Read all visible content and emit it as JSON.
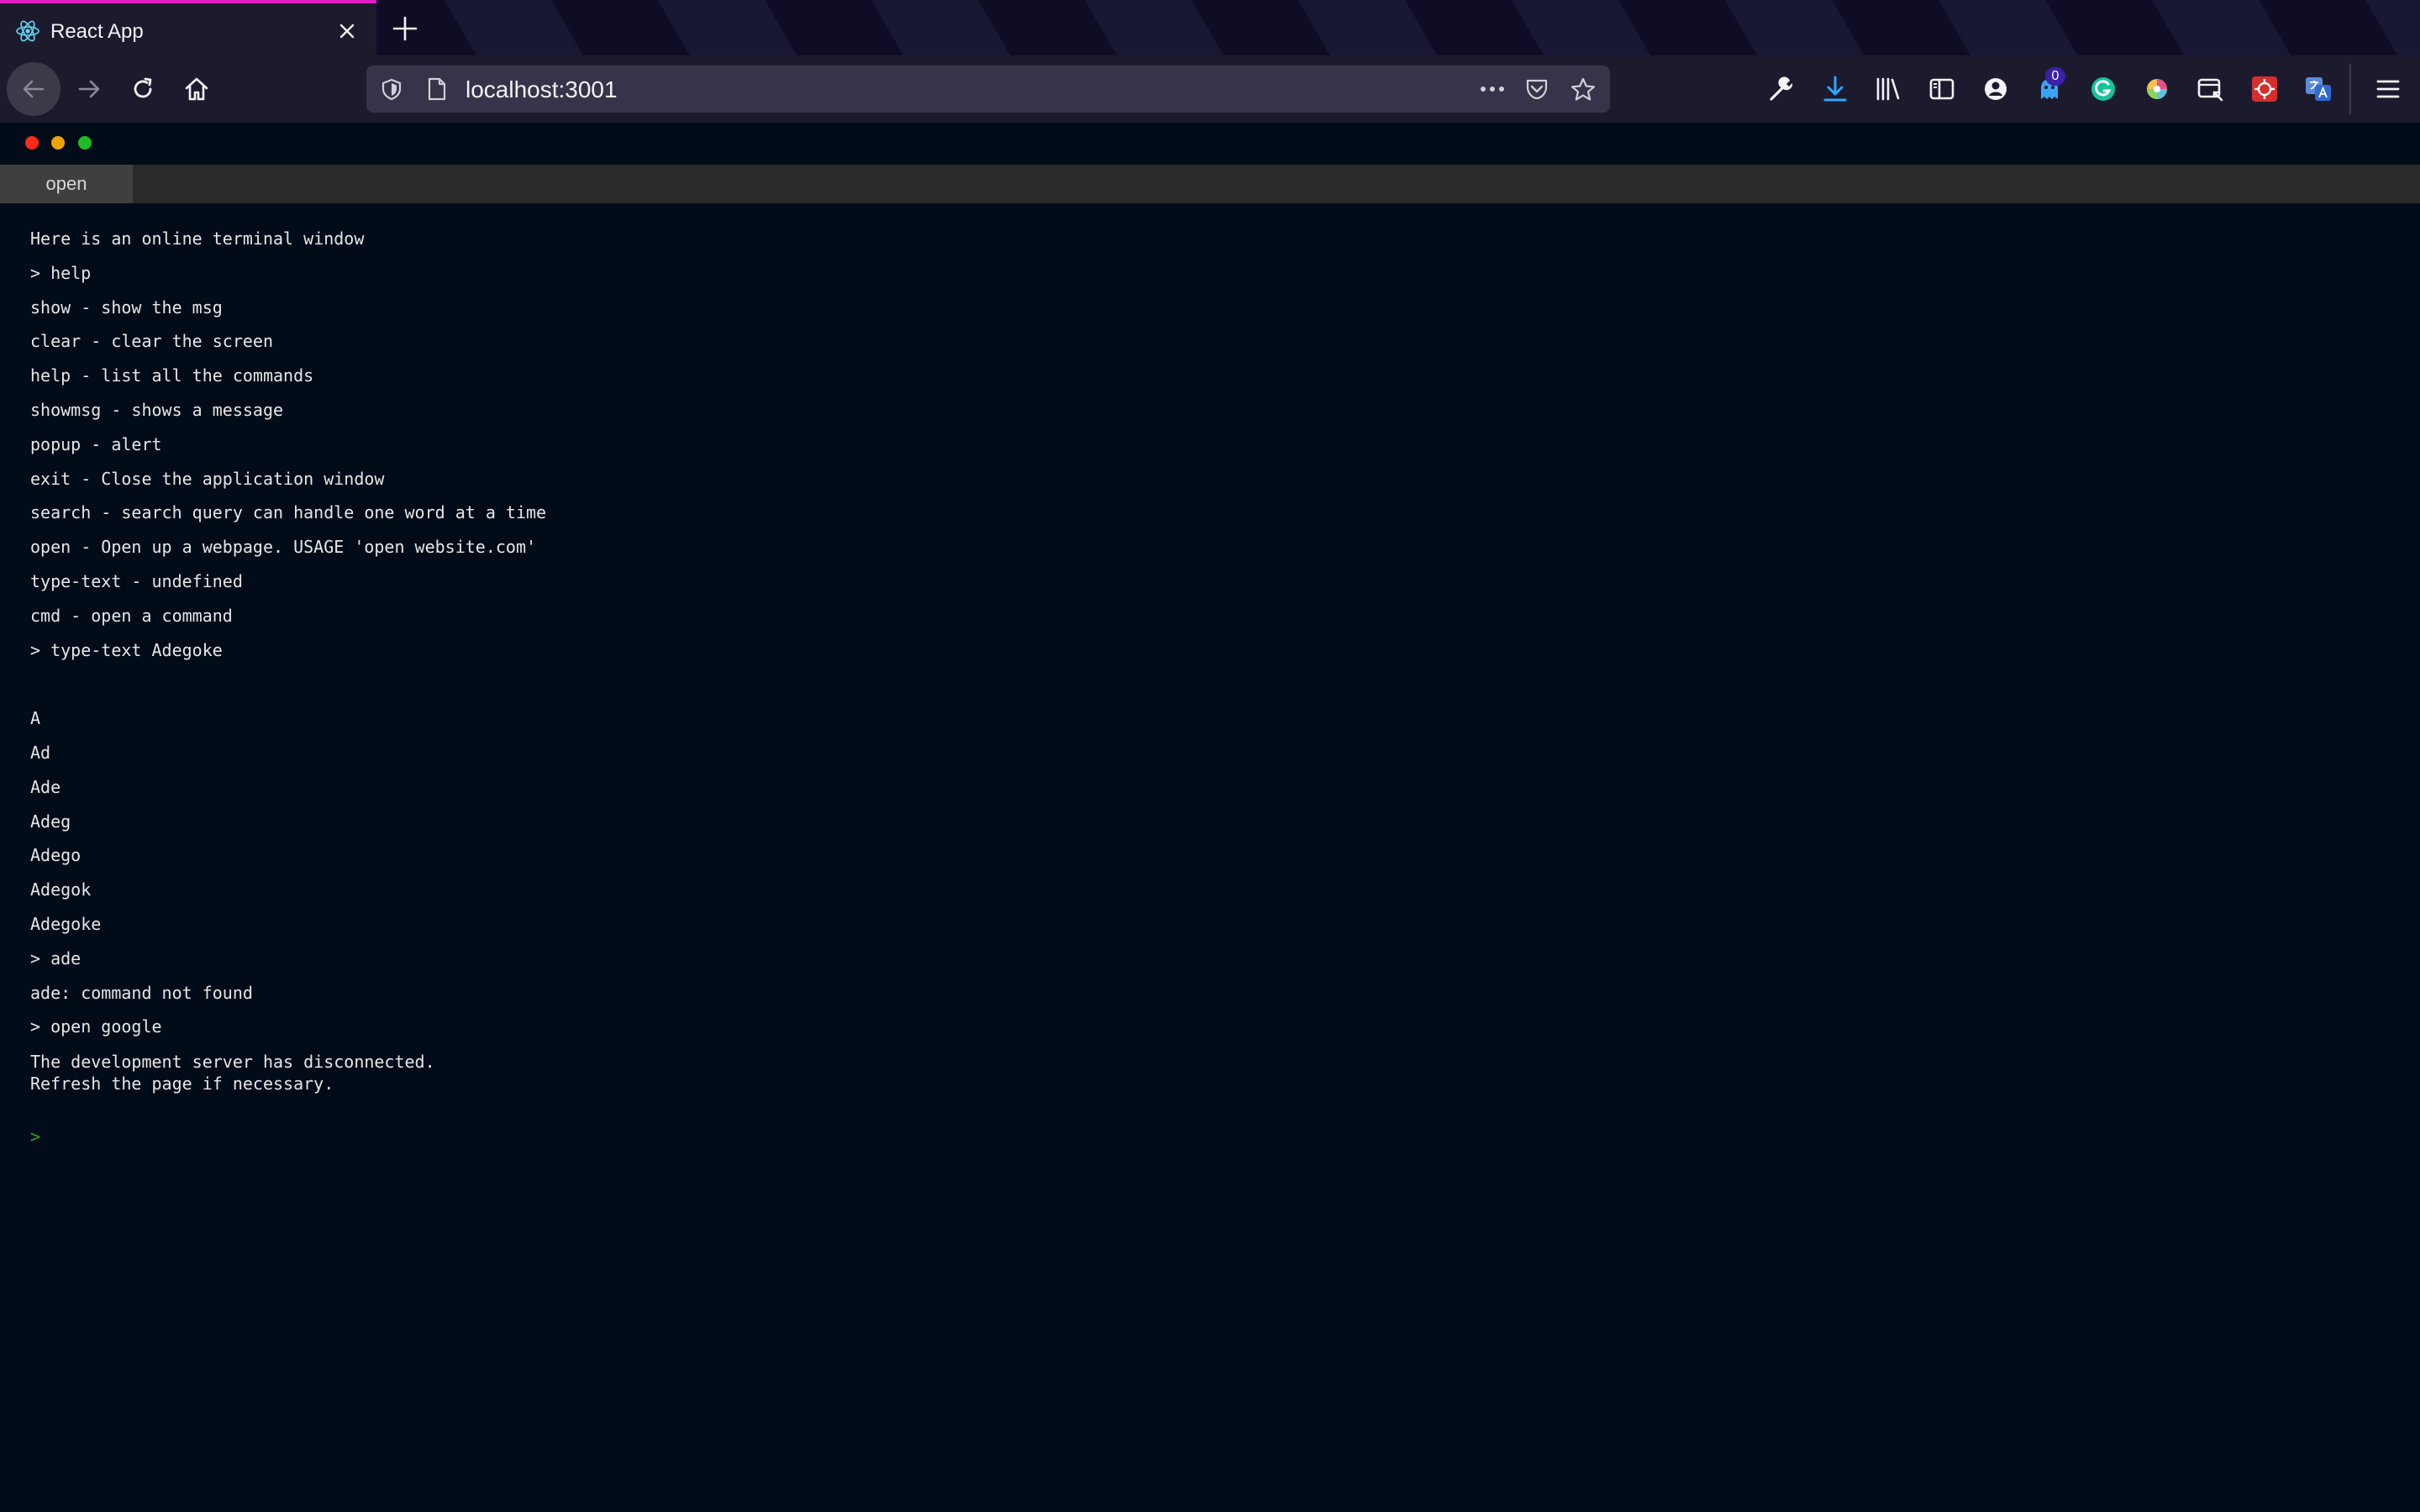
{
  "browser": {
    "tab_title": "React App",
    "url": "localhost:3001",
    "badge_count": "0",
    "accent_color": "#e21bc2"
  },
  "terminal": {
    "tab_label": "open",
    "lines": [
      "Here is an online terminal window",
      "> help",
      "show - show the msg",
      "clear - clear the screen",
      "help - list all the commands",
      "showmsg - shows a message",
      "popup - alert",
      "exit - Close the application window",
      "search - search query can handle one word at a time",
      "open - Open up a webpage. USAGE 'open website.com'",
      "type-text - undefined",
      "cmd - open a command",
      "> type-text Adegoke",
      "",
      "A",
      "Ad",
      "Ade",
      "Adeg",
      "Adego",
      "Adegok",
      "Adegoke",
      "> ade",
      "ade: command not found",
      "> open google"
    ],
    "disconnect_line1": "The development server has disconnected.",
    "disconnect_line2": "Refresh the page if necessary.",
    "prompt_symbol": ">",
    "prompt_color": "#29a329"
  }
}
